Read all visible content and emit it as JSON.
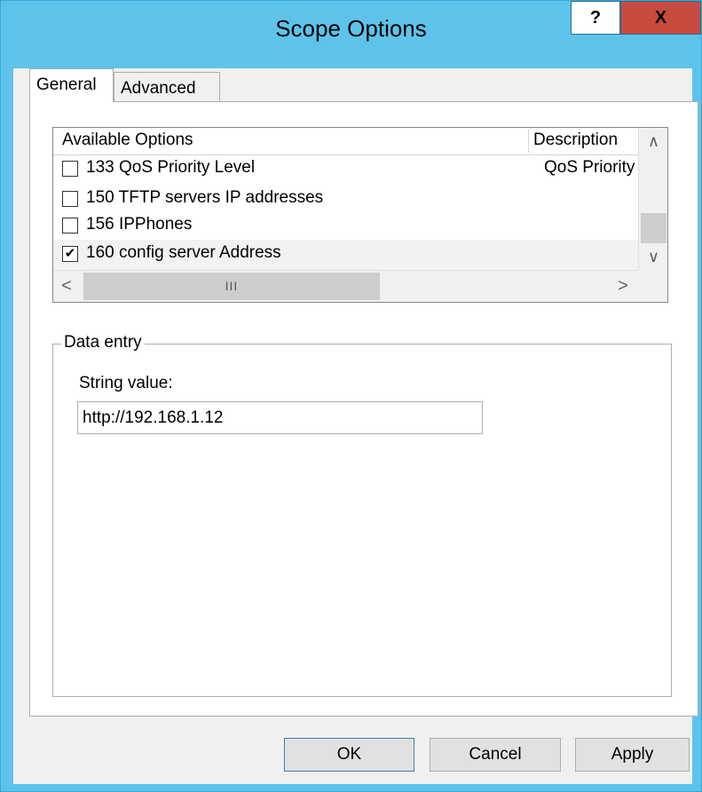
{
  "window": {
    "title": "Scope Options",
    "help_glyph": "?",
    "close_glyph": "X",
    "titlebar_color": "#5ec3ea",
    "close_color": "#c94a3f"
  },
  "tabs": [
    {
      "label": "General",
      "selected": true
    },
    {
      "label": "Advanced",
      "selected": false
    }
  ],
  "options_list": {
    "columns": [
      "Available Options",
      "Description"
    ],
    "rows": [
      {
        "checked": false,
        "name": "133 QoS Priority Level",
        "description": "QoS Priority"
      },
      {
        "checked": false,
        "name": "150 TFTP servers IP addresses",
        "description": ""
      },
      {
        "checked": false,
        "name": "156 IPPhones",
        "description": ""
      },
      {
        "checked": true,
        "name": "160 config server Address",
        "description": ""
      }
    ],
    "scroll_up_glyph": "∧",
    "scroll_down_glyph": "∨",
    "scroll_left_glyph": "<",
    "scroll_right_glyph": ">",
    "hscroll_thumb_grip": "III"
  },
  "data_entry": {
    "group_label": "Data entry",
    "field_label": "String value:",
    "field_value": "http://192.168.1.12"
  },
  "buttons": {
    "ok": "OK",
    "cancel": "Cancel",
    "apply": "Apply"
  }
}
